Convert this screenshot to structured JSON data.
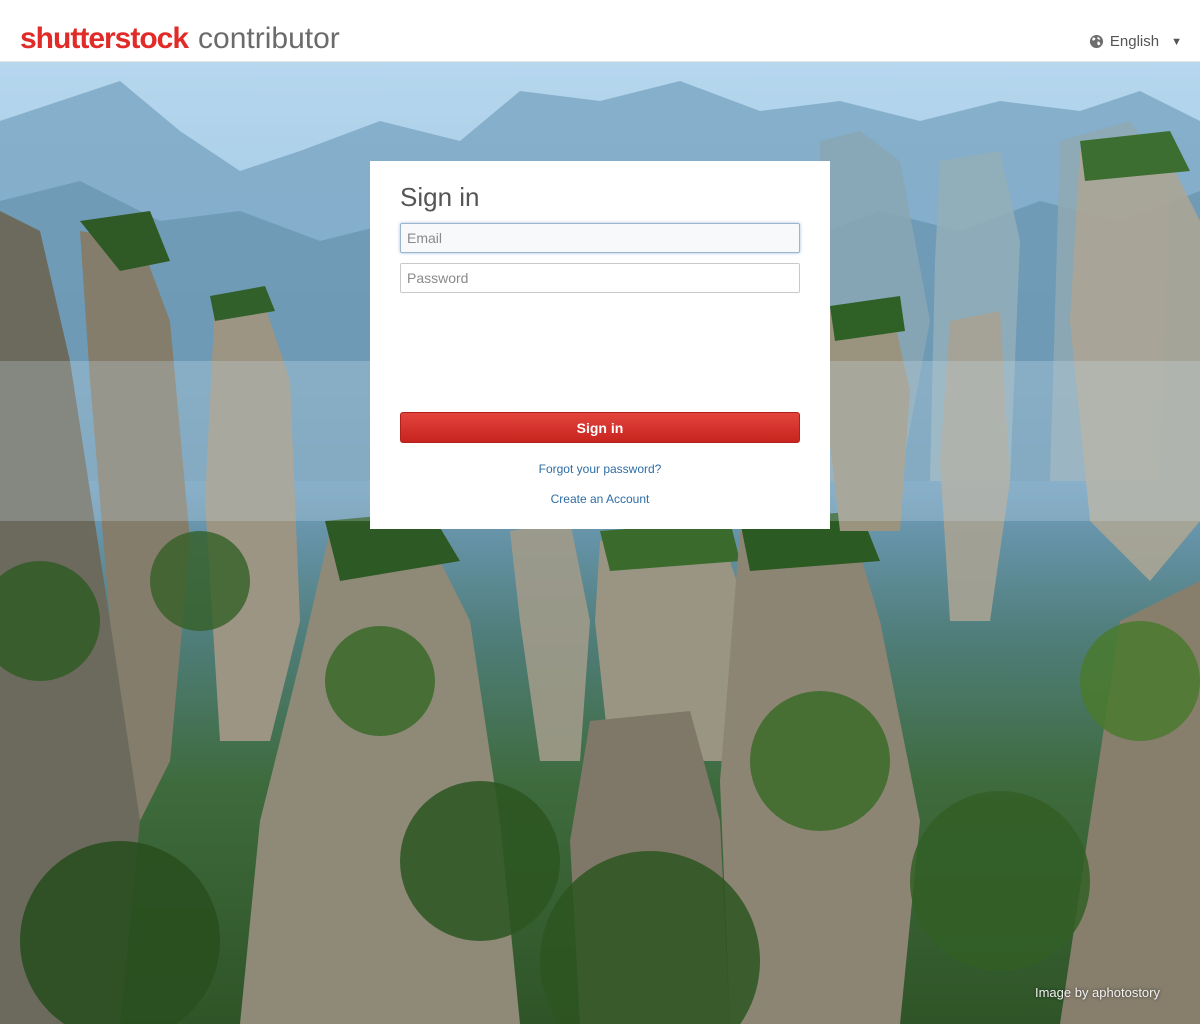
{
  "header": {
    "brand": "shutterstock",
    "product": "contributor",
    "language": "English",
    "globe_icon": "globe-icon",
    "caret_icon": "chevron-down-icon"
  },
  "signin": {
    "title": "Sign in",
    "email_placeholder": "Email",
    "email_value": "",
    "password_placeholder": "Password",
    "password_value": "",
    "button_label": "Sign in",
    "forgot_link": "Forgot your password?",
    "create_link": "Create an Account"
  },
  "background": {
    "credit": "Image by aphotostory"
  },
  "colors": {
    "brand_red": "#e12b28",
    "button_red": "#d1322b",
    "link_blue": "#2e6da4"
  }
}
